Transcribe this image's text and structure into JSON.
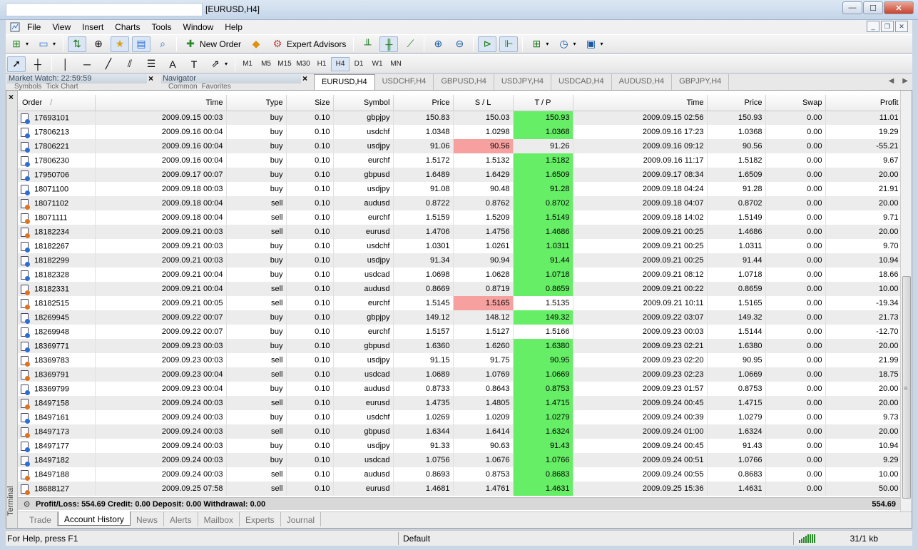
{
  "window": {
    "title": "[EURUSD,H4]",
    "minimize": "—",
    "maximize": "☐",
    "close": "✕"
  },
  "menu": [
    "File",
    "View",
    "Insert",
    "Charts",
    "Tools",
    "Window",
    "Help"
  ],
  "toolbar": {
    "new_order": "New Order",
    "expert_advisors": "Expert Advisors"
  },
  "timeframes": [
    "M1",
    "M5",
    "M15",
    "M30",
    "H1",
    "H4",
    "D1",
    "W1",
    "MN"
  ],
  "active_timeframe": "H4",
  "panels": {
    "market_watch": "Market Watch: 22:59:59",
    "market_watch_tabs": [
      "Symbols",
      "Tick Chart"
    ],
    "navigator": "Navigator",
    "navigator_tabs": [
      "Common",
      "Favorites"
    ]
  },
  "chart_tabs": [
    "EURUSD,H4",
    "USDCHF,H4",
    "GBPUSD,H4",
    "USDJPY,H4",
    "USDCAD,H4",
    "AUDUSD,H4",
    "GBPJPY,H4"
  ],
  "active_chart_tab": "EURUSD,H4",
  "table": {
    "columns": [
      "Order",
      "Time",
      "Type",
      "Size",
      "Symbol",
      "Price",
      "S / L",
      "T / P",
      "Time",
      "Price",
      "Swap",
      "Profit"
    ],
    "sort_indicator": "/",
    "rows": [
      {
        "order": "17693101",
        "open_time": "2009.09.15 00:03",
        "type": "buy",
        "size": "0.10",
        "symbol": "gbpjpy",
        "open_price": "150.83",
        "sl": "150.03",
        "tp": "150.93",
        "close_time": "2009.09.15 02:56",
        "close_price": "150.93",
        "swap": "0.00",
        "profit": "11.01",
        "hit": "tp"
      },
      {
        "order": "17806213",
        "open_time": "2009.09.16 00:04",
        "type": "buy",
        "size": "0.10",
        "symbol": "usdchf",
        "open_price": "1.0348",
        "sl": "1.0298",
        "tp": "1.0368",
        "close_time": "2009.09.16 17:23",
        "close_price": "1.0368",
        "swap": "0.00",
        "profit": "19.29",
        "hit": "tp"
      },
      {
        "order": "17806221",
        "open_time": "2009.09.16 00:04",
        "type": "buy",
        "size": "0.10",
        "symbol": "usdjpy",
        "open_price": "91.06",
        "sl": "90.56",
        "tp": "91.26",
        "close_time": "2009.09.16 09:12",
        "close_price": "90.56",
        "swap": "0.00",
        "profit": "-55.21",
        "hit": "sl"
      },
      {
        "order": "17806230",
        "open_time": "2009.09.16 00:04",
        "type": "buy",
        "size": "0.10",
        "symbol": "eurchf",
        "open_price": "1.5172",
        "sl": "1.5132",
        "tp": "1.5182",
        "close_time": "2009.09.16 11:17",
        "close_price": "1.5182",
        "swap": "0.00",
        "profit": "9.67",
        "hit": "tp"
      },
      {
        "order": "17950706",
        "open_time": "2009.09.17 00:07",
        "type": "buy",
        "size": "0.10",
        "symbol": "gbpusd",
        "open_price": "1.6489",
        "sl": "1.6429",
        "tp": "1.6509",
        "close_time": "2009.09.17 08:34",
        "close_price": "1.6509",
        "swap": "0.00",
        "profit": "20.00",
        "hit": "tp"
      },
      {
        "order": "18071100",
        "open_time": "2009.09.18 00:03",
        "type": "buy",
        "size": "0.10",
        "symbol": "usdjpy",
        "open_price": "91.08",
        "sl": "90.48",
        "tp": "91.28",
        "close_time": "2009.09.18 04:24",
        "close_price": "91.28",
        "swap": "0.00",
        "profit": "21.91",
        "hit": "tp"
      },
      {
        "order": "18071102",
        "open_time": "2009.09.18 00:04",
        "type": "sell",
        "size": "0.10",
        "symbol": "audusd",
        "open_price": "0.8722",
        "sl": "0.8762",
        "tp": "0.8702",
        "close_time": "2009.09.18 04:07",
        "close_price": "0.8702",
        "swap": "0.00",
        "profit": "20.00",
        "hit": "tp"
      },
      {
        "order": "18071111",
        "open_time": "2009.09.18 00:04",
        "type": "sell",
        "size": "0.10",
        "symbol": "eurchf",
        "open_price": "1.5159",
        "sl": "1.5209",
        "tp": "1.5149",
        "close_time": "2009.09.18 14:02",
        "close_price": "1.5149",
        "swap": "0.00",
        "profit": "9.71",
        "hit": "tp"
      },
      {
        "order": "18182234",
        "open_time": "2009.09.21 00:03",
        "type": "sell",
        "size": "0.10",
        "symbol": "eurusd",
        "open_price": "1.4706",
        "sl": "1.4756",
        "tp": "1.4686",
        "close_time": "2009.09.21 00:25",
        "close_price": "1.4686",
        "swap": "0.00",
        "profit": "20.00",
        "hit": "tp"
      },
      {
        "order": "18182267",
        "open_time": "2009.09.21 00:03",
        "type": "buy",
        "size": "0.10",
        "symbol": "usdchf",
        "open_price": "1.0301",
        "sl": "1.0261",
        "tp": "1.0311",
        "close_time": "2009.09.21 00:25",
        "close_price": "1.0311",
        "swap": "0.00",
        "profit": "9.70",
        "hit": "tp"
      },
      {
        "order": "18182299",
        "open_time": "2009.09.21 00:03",
        "type": "buy",
        "size": "0.10",
        "symbol": "usdjpy",
        "open_price": "91.34",
        "sl": "90.94",
        "tp": "91.44",
        "close_time": "2009.09.21 00:25",
        "close_price": "91.44",
        "swap": "0.00",
        "profit": "10.94",
        "hit": "tp"
      },
      {
        "order": "18182328",
        "open_time": "2009.09.21 00:04",
        "type": "buy",
        "size": "0.10",
        "symbol": "usdcad",
        "open_price": "1.0698",
        "sl": "1.0628",
        "tp": "1.0718",
        "close_time": "2009.09.21 08:12",
        "close_price": "1.0718",
        "swap": "0.00",
        "profit": "18.66",
        "hit": "tp"
      },
      {
        "order": "18182331",
        "open_time": "2009.09.21 00:04",
        "type": "sell",
        "size": "0.10",
        "symbol": "audusd",
        "open_price": "0.8669",
        "sl": "0.8719",
        "tp": "0.8659",
        "close_time": "2009.09.21 00:22",
        "close_price": "0.8659",
        "swap": "0.00",
        "profit": "10.00",
        "hit": "tp"
      },
      {
        "order": "18182515",
        "open_time": "2009.09.21 00:05",
        "type": "sell",
        "size": "0.10",
        "symbol": "eurchf",
        "open_price": "1.5145",
        "sl": "1.5165",
        "tp": "1.5135",
        "close_time": "2009.09.21 10:11",
        "close_price": "1.5165",
        "swap": "0.00",
        "profit": "-19.34",
        "hit": "sl"
      },
      {
        "order": "18269945",
        "open_time": "2009.09.22 00:07",
        "type": "buy",
        "size": "0.10",
        "symbol": "gbpjpy",
        "open_price": "149.12",
        "sl": "148.12",
        "tp": "149.32",
        "close_time": "2009.09.22 03:07",
        "close_price": "149.32",
        "swap": "0.00",
        "profit": "21.73",
        "hit": "tp"
      },
      {
        "order": "18269948",
        "open_time": "2009.09.22 00:07",
        "type": "buy",
        "size": "0.10",
        "symbol": "eurchf",
        "open_price": "1.5157",
        "sl": "1.5127",
        "tp": "1.5166",
        "close_time": "2009.09.23 00:03",
        "close_price": "1.5144",
        "swap": "0.00",
        "profit": "-12.70",
        "hit": "none"
      },
      {
        "order": "18369771",
        "open_time": "2009.09.23 00:03",
        "type": "buy",
        "size": "0.10",
        "symbol": "gbpusd",
        "open_price": "1.6360",
        "sl": "1.6260",
        "tp": "1.6380",
        "close_time": "2009.09.23 02:21",
        "close_price": "1.6380",
        "swap": "0.00",
        "profit": "20.00",
        "hit": "tp"
      },
      {
        "order": "18369783",
        "open_time": "2009.09.23 00:03",
        "type": "sell",
        "size": "0.10",
        "symbol": "usdjpy",
        "open_price": "91.15",
        "sl": "91.75",
        "tp": "90.95",
        "close_time": "2009.09.23 02:20",
        "close_price": "90.95",
        "swap": "0.00",
        "profit": "21.99",
        "hit": "tp"
      },
      {
        "order": "18369791",
        "open_time": "2009.09.23 00:04",
        "type": "sell",
        "size": "0.10",
        "symbol": "usdcad",
        "open_price": "1.0689",
        "sl": "1.0769",
        "tp": "1.0669",
        "close_time": "2009.09.23 02:23",
        "close_price": "1.0669",
        "swap": "0.00",
        "profit": "18.75",
        "hit": "tp"
      },
      {
        "order": "18369799",
        "open_time": "2009.09.23 00:04",
        "type": "buy",
        "size": "0.10",
        "symbol": "audusd",
        "open_price": "0.8733",
        "sl": "0.8643",
        "tp": "0.8753",
        "close_time": "2009.09.23 01:57",
        "close_price": "0.8753",
        "swap": "0.00",
        "profit": "20.00",
        "hit": "tp"
      },
      {
        "order": "18497158",
        "open_time": "2009.09.24 00:03",
        "type": "sell",
        "size": "0.10",
        "symbol": "eurusd",
        "open_price": "1.4735",
        "sl": "1.4805",
        "tp": "1.4715",
        "close_time": "2009.09.24 00:45",
        "close_price": "1.4715",
        "swap": "0.00",
        "profit": "20.00",
        "hit": "tp"
      },
      {
        "order": "18497161",
        "open_time": "2009.09.24 00:03",
        "type": "buy",
        "size": "0.10",
        "symbol": "usdchf",
        "open_price": "1.0269",
        "sl": "1.0209",
        "tp": "1.0279",
        "close_time": "2009.09.24 00:39",
        "close_price": "1.0279",
        "swap": "0.00",
        "profit": "9.73",
        "hit": "tp"
      },
      {
        "order": "18497173",
        "open_time": "2009.09.24 00:03",
        "type": "sell",
        "size": "0.10",
        "symbol": "gbpusd",
        "open_price": "1.6344",
        "sl": "1.6414",
        "tp": "1.6324",
        "close_time": "2009.09.24 01:00",
        "close_price": "1.6324",
        "swap": "0.00",
        "profit": "20.00",
        "hit": "tp"
      },
      {
        "order": "18497177",
        "open_time": "2009.09.24 00:03",
        "type": "buy",
        "size": "0.10",
        "symbol": "usdjpy",
        "open_price": "91.33",
        "sl": "90.63",
        "tp": "91.43",
        "close_time": "2009.09.24 00:45",
        "close_price": "91.43",
        "swap": "0.00",
        "profit": "10.94",
        "hit": "tp"
      },
      {
        "order": "18497182",
        "open_time": "2009.09.24 00:03",
        "type": "buy",
        "size": "0.10",
        "symbol": "usdcad",
        "open_price": "1.0756",
        "sl": "1.0676",
        "tp": "1.0766",
        "close_time": "2009.09.24 00:51",
        "close_price": "1.0766",
        "swap": "0.00",
        "profit": "9.29",
        "hit": "tp"
      },
      {
        "order": "18497188",
        "open_time": "2009.09.24 00:03",
        "type": "sell",
        "size": "0.10",
        "symbol": "audusd",
        "open_price": "0.8693",
        "sl": "0.8753",
        "tp": "0.8683",
        "close_time": "2009.09.24 00:55",
        "close_price": "0.8683",
        "swap": "0.00",
        "profit": "10.00",
        "hit": "tp"
      },
      {
        "order": "18688127",
        "open_time": "2009.09.25 07:58",
        "type": "sell",
        "size": "0.10",
        "symbol": "eurusd",
        "open_price": "1.4681",
        "sl": "1.4761",
        "tp": "1.4631",
        "close_time": "2009.09.25 15:36",
        "close_price": "1.4631",
        "swap": "0.00",
        "profit": "50.00",
        "hit": "tp"
      }
    ]
  },
  "summary": {
    "text": "Profit/Loss: 554.69  Credit: 0.00  Deposit: 0.00  Withdrawal: 0.00",
    "total": "554.69"
  },
  "terminal": {
    "label": "Terminal",
    "close": "×",
    "tabs": [
      "Trade",
      "Account History",
      "News",
      "Alerts",
      "Mailbox",
      "Experts",
      "Journal"
    ],
    "active_tab": "Account History"
  },
  "status": {
    "help": "For Help, press F1",
    "profile": "Default",
    "traffic": "31/1 kb"
  },
  "colors": {
    "sl_hit": "#f7a0a0",
    "tp_hit": "#66ee66",
    "buy_icon": "#2a6fd6",
    "sell_icon": "#e0731a"
  }
}
